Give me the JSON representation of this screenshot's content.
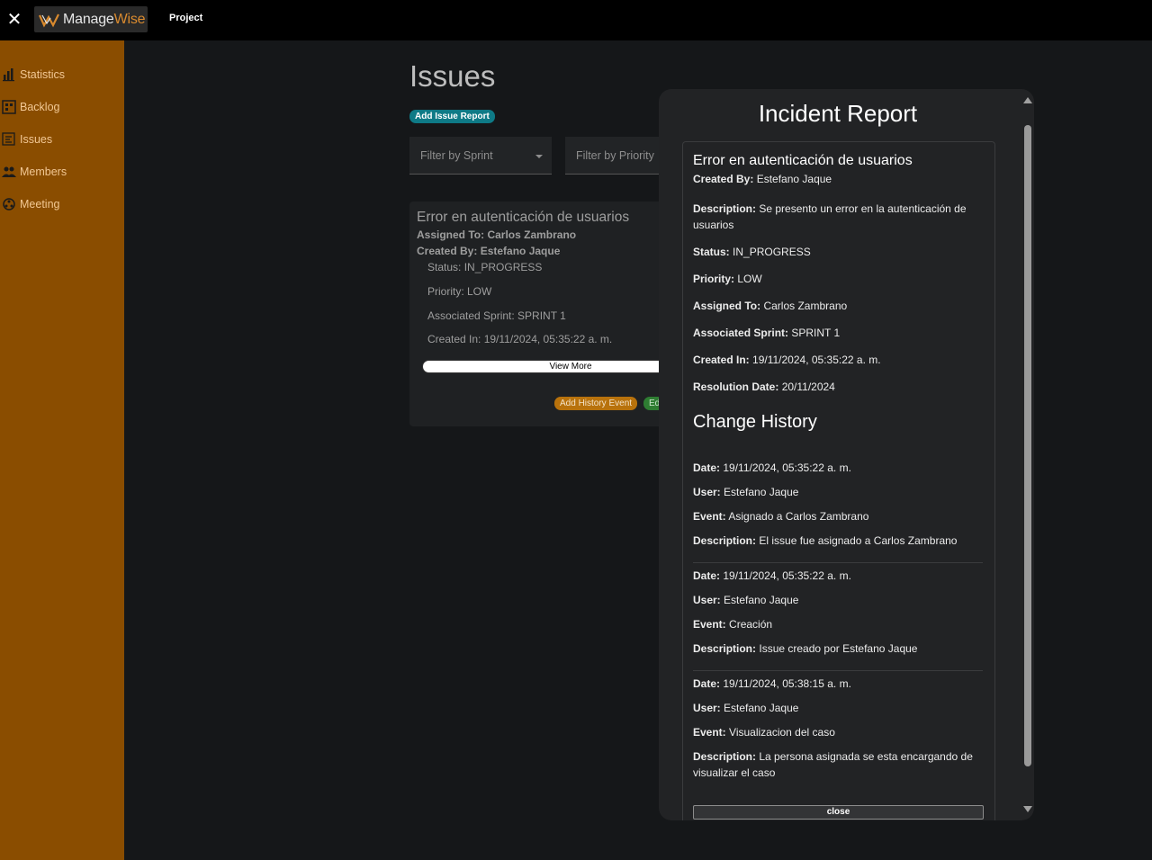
{
  "topbar": {
    "brand_part1": "Manage",
    "brand_part2": "Wise",
    "nav_project": "Project",
    "close_glyph": "✕"
  },
  "sidebar": {
    "items": [
      {
        "label": "Statistics",
        "icon": "bar-chart-icon"
      },
      {
        "label": "Backlog",
        "icon": "backlog-icon"
      },
      {
        "label": "Issues",
        "icon": "issues-icon"
      },
      {
        "label": "Members",
        "icon": "members-icon"
      },
      {
        "label": "Meeting",
        "icon": "meeting-icon"
      }
    ]
  },
  "main": {
    "title": "Issues",
    "add_issue_label": "Add Issue Report",
    "filter_sprint": "Filter by Sprint",
    "filter_priority": "Filter by Priority",
    "card": {
      "title": "Error en autenticación de usuarios",
      "assigned": "Assigned To: Carlos Zambrano",
      "created_by": "Created By: Estefano Jaque",
      "status": "Status: IN_PROGRESS",
      "priority": "Priority: LOW",
      "sprint": "Associated Sprint: SPRINT 1",
      "created_in": "Created In: 19/11/2024, 05:35:22 a. m.",
      "view_more": "View More",
      "add_history": "Add History Event",
      "edit": "Edit"
    }
  },
  "modal": {
    "title": "Incident Report",
    "issue_title": "Error en autenticación de usuarios",
    "fields": {
      "created_by_label": "Created By:",
      "created_by": "Estefano Jaque",
      "description_label": "Description:",
      "description": "Se presento un error en la autenticación de usuarios",
      "status_label": "Status:",
      "status": "IN_PROGRESS",
      "priority_label": "Priority:",
      "priority": "LOW",
      "assigned_label": "Assigned To:",
      "assigned": "Carlos Zambrano",
      "sprint_label": "Associated Sprint:",
      "sprint": "SPRINT 1",
      "created_in_label": "Created In:",
      "created_in": "19/11/2024, 05:35:22 a. m.",
      "resolution_label": "Resolution Date:",
      "resolution": "20/11/2024"
    },
    "history_title": "Change History",
    "history_labels": {
      "date": "Date:",
      "user": "User:",
      "event": "Event:",
      "description": "Description:"
    },
    "history": [
      {
        "date": "19/11/2024, 05:35:22 a. m.",
        "user": "Estefano Jaque",
        "event": "Asignado a Carlos Zambrano",
        "description": "El issue fue asignado a Carlos Zambrano"
      },
      {
        "date": "19/11/2024, 05:35:22 a. m.",
        "user": "Estefano Jaque",
        "event": "Creación",
        "description": "Issue creado por Estefano Jaque"
      },
      {
        "date": "19/11/2024, 05:38:15 a. m.",
        "user": "Estefano Jaque",
        "event": "Visualizacion del caso",
        "description": "La persona asignada se esta encargando de visualizar el caso"
      }
    ],
    "close_label": "close"
  }
}
